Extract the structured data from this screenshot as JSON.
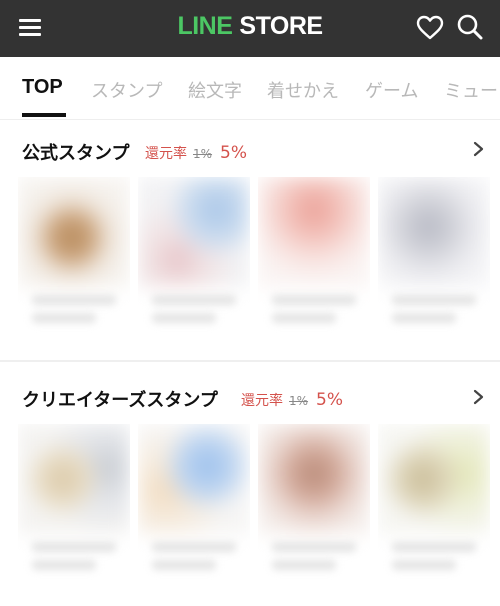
{
  "header": {
    "logo_line": "LINE",
    "logo_store": "STORE",
    "brand_color": "#4cc764",
    "background": "#333333"
  },
  "tabs": [
    {
      "label": "TOP",
      "active": true
    },
    {
      "label": "スタンプ",
      "active": false
    },
    {
      "label": "絵文字",
      "active": false
    },
    {
      "label": "着せかえ",
      "active": false
    },
    {
      "label": "ゲーム",
      "active": false
    },
    {
      "label": "ミュー",
      "active": false
    }
  ],
  "sections": [
    {
      "title": "公式スタンプ",
      "rebate_label": "還元率",
      "rebate_old": "1%",
      "rebate_new": "5%"
    },
    {
      "title": "クリエイターズスタンプ",
      "rebate_label": "還元率",
      "rebate_old": "1%",
      "rebate_new": "5%"
    }
  ],
  "accent_color": "#d4524c"
}
